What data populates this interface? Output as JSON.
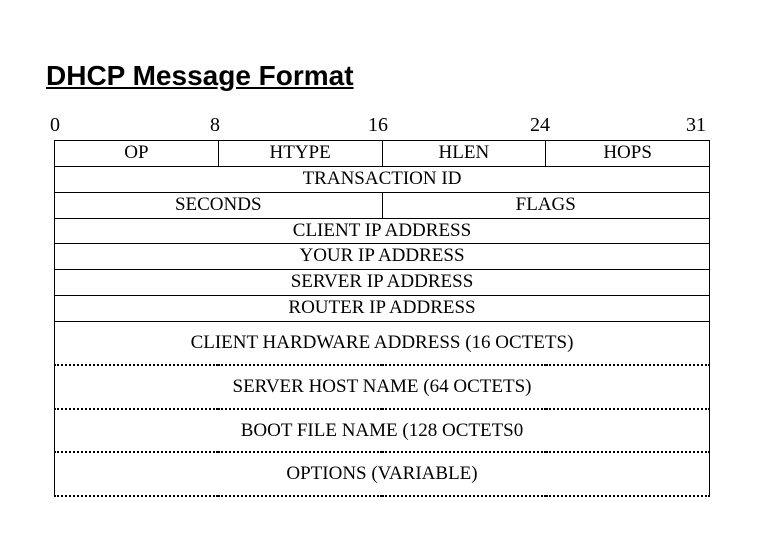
{
  "title": "DHCP Message Format",
  "ruler": {
    "b0": "0",
    "b8": "8",
    "b16": "16",
    "b24": "24",
    "b31": "31"
  },
  "rows": {
    "r1": {
      "op": "OP",
      "htype": "HTYPE",
      "hlen": "HLEN",
      "hops": "HOPS"
    },
    "r2": "TRANSACTION ID",
    "r3": {
      "seconds": "SECONDS",
      "flags": "FLAGS"
    },
    "r4": "CLIENT IP ADDRESS",
    "r5": "YOUR IP ADDRESS",
    "r6": "SERVER IP ADDRESS",
    "r7": "ROUTER IP ADDRESS",
    "r8": "CLIENT HARDWARE ADDRESS (16 OCTETS)",
    "r9": "SERVER HOST NAME (64 OCTETS)",
    "r10": "BOOT FILE NAME (128 OCTETS0",
    "r11": "OPTIONS (VARIABLE)"
  }
}
